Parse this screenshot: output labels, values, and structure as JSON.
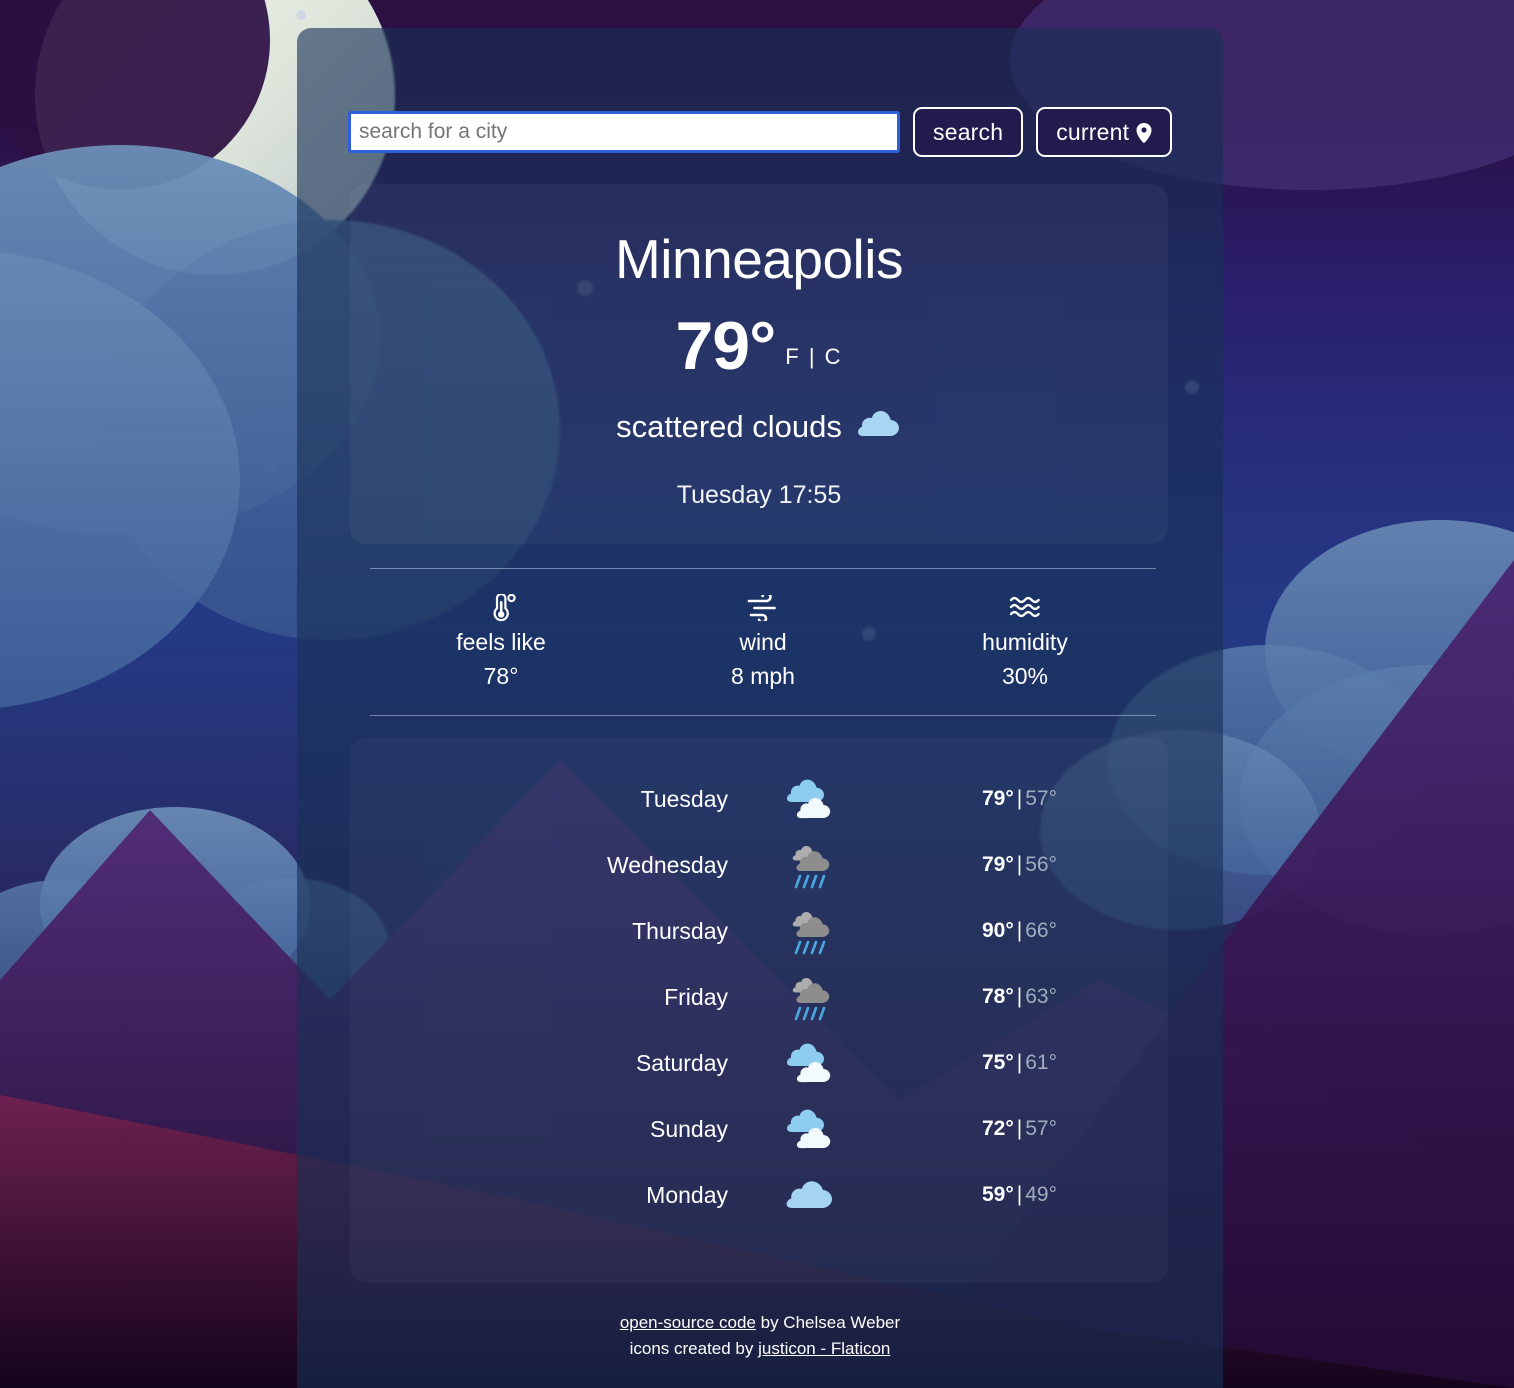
{
  "search": {
    "placeholder": "search for a city",
    "value": "",
    "search_button": "search",
    "current_button": "current",
    "pin_icon": "location-pin-icon"
  },
  "current": {
    "city": "Minneapolis",
    "temperature": "79°",
    "unit_toggle": "F | C",
    "unit_f": "F",
    "unit_c": "C",
    "description": "scattered clouds",
    "description_icon": "scattered-clouds-icon",
    "datetime": "Tuesday 17:55"
  },
  "stats": [
    {
      "icon": "thermometer-icon",
      "label": "feels like",
      "value": "78°"
    },
    {
      "icon": "wind-icon",
      "label": "wind",
      "value": "8 mph"
    },
    {
      "icon": "humidity-icon",
      "label": "humidity",
      "value": "30%"
    }
  ],
  "forecast": [
    {
      "day": "Tuesday",
      "icon": "scattered-clouds-icon",
      "high": "79°",
      "sep": "|",
      "low": "57°"
    },
    {
      "day": "Wednesday",
      "icon": "rain-icon",
      "high": "79°",
      "sep": "|",
      "low": "56°"
    },
    {
      "day": "Thursday",
      "icon": "rain-icon",
      "high": "90°",
      "sep": "|",
      "low": "66°"
    },
    {
      "day": "Friday",
      "icon": "rain-icon",
      "high": "78°",
      "sep": "|",
      "low": "63°"
    },
    {
      "day": "Saturday",
      "icon": "scattered-clouds-icon",
      "high": "75°",
      "sep": "|",
      "low": "61°"
    },
    {
      "day": "Sunday",
      "icon": "scattered-clouds-icon",
      "high": "72°",
      "sep": "|",
      "low": "57°"
    },
    {
      "day": "Monday",
      "icon": "cloud-icon",
      "high": "59°",
      "sep": "|",
      "low": "49°"
    }
  ],
  "footer": {
    "line1_link": "open-source code",
    "line1_rest": " by Chelsea Weber",
    "line2_prefix": "icons created by ",
    "line2_link": "justicon - Flaticon"
  },
  "colors": {
    "panel": "#183156",
    "button_bg": "#221c4e",
    "input_border": "#2c5fd8",
    "text": "#ffffff",
    "low_temp": "#9fadbe",
    "cloud_light": "#a8d5f2",
    "cloud_white": "#eef7fd",
    "cloud_gray": "#9b9b9b",
    "rain_blue": "#4aa8e0"
  }
}
